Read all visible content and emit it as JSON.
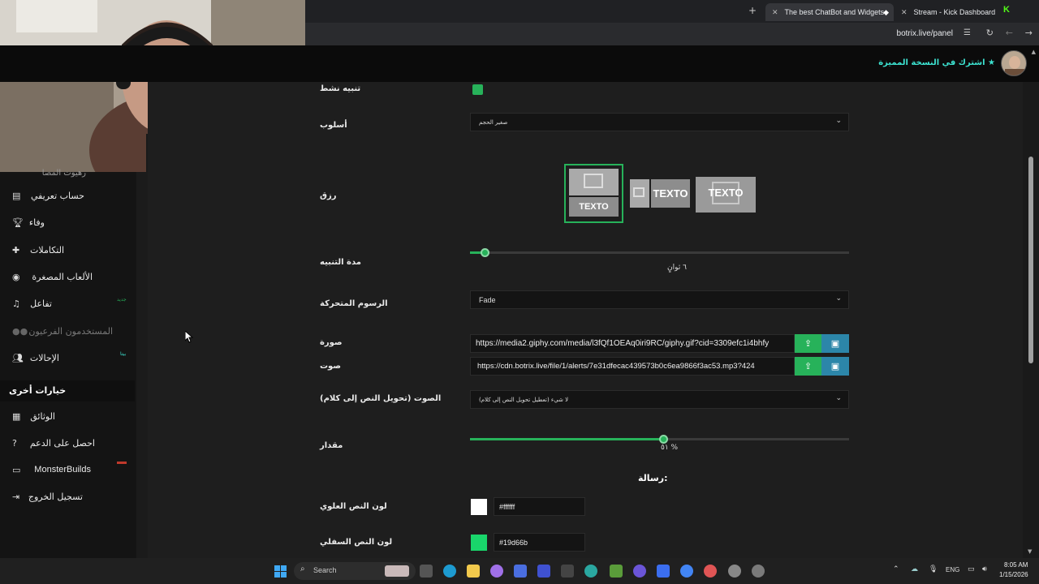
{
  "browser": {
    "tabs": [
      {
        "title": "The best ChatBot and Widgets",
        "active": true
      },
      {
        "title": "Stream - Kick Dashboard",
        "active": false
      }
    ],
    "url": "botrix.live/panel"
  },
  "header": {
    "upgrade_label": "اشترك في النسخة المميزة"
  },
  "sidebar": {
    "items": [
      {
        "label": "حساب تعريفي",
        "icon": "id-card-icon"
      },
      {
        "label": "وفاء",
        "icon": "trophy-icon"
      },
      {
        "label": "التكاملات",
        "icon": "puzzle-icon"
      },
      {
        "label": "الألعاب المصغرة",
        "icon": "gamepad-icon"
      },
      {
        "label": "تفاعل",
        "icon": "music-icon",
        "badge": "جديد"
      },
      {
        "label": "المستخدمون الفرعيون",
        "icon": "users-icon",
        "disabled": true
      },
      {
        "label": "الإحالات",
        "icon": "user-group-icon",
        "badge": "بيتا"
      }
    ],
    "section_title": "خيارات أخرى",
    "other_items": [
      {
        "label": "الوثائق",
        "icon": "book-icon"
      },
      {
        "label": "احصل على الدعم",
        "icon": "help-circle-icon"
      },
      {
        "label": "MonsterBuilds",
        "icon": "laptop-icon"
      },
      {
        "label": "تسجيل الخروج",
        "icon": "logout-icon"
      }
    ]
  },
  "form": {
    "active_alert_label": "تنبيه نشط",
    "style_label": "أسلوب",
    "style_value": "صغير الحجم",
    "layout_label": "رزق",
    "layout_options": [
      "TEXTO",
      "TEXTO",
      "TEXTO"
    ],
    "duration_label": "مدة التنبيه",
    "duration_value": "٦ ثوانٍ",
    "duration_fraction": 0.04,
    "animation_label": "الرسوم المتحركة",
    "animation_value": "Fade",
    "image_label": "صورة",
    "image_url": "https://media2.giphy.com/media/l3fQf1OEAq0iri9RC/giphy.gif?cid=3309efc1i4bhfy",
    "sound_label": "صوت",
    "sound_url": "https://cdn.botrix.live/file/1/alerts/7e31dfecac439573b0c6ea9866f3ac53.mp3?424",
    "tts_label": "الصوت (تحويل النص إلى كلام)",
    "tts_value": "لا شيء (تعطيل تحويل النص إلى كلام)",
    "volume_label": "مقدار",
    "volume_value": "٥١ %",
    "volume_fraction": 0.51,
    "message_heading": "رسالة:",
    "top_color_label": "لون النص العلوي",
    "top_color": "#ffffff",
    "top_color_text": "#ffffff",
    "bottom_color_label": "لون النص السفلي",
    "bottom_color": "#19d66b",
    "bottom_color_text": "#19d66b"
  },
  "taskbar": {
    "search_label": "Search",
    "lang": "ENG",
    "time": "8:05 AM",
    "date": "1/15/2026"
  },
  "colors": {
    "accent_green": "#27b25a",
    "teal": "#2c86a9",
    "upgrade_text": "#3ce2d0"
  }
}
